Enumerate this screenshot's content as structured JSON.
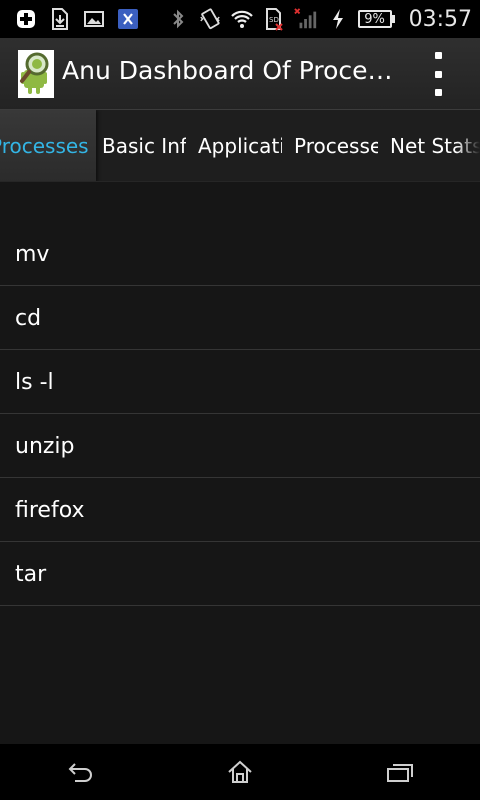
{
  "status_bar": {
    "icons": [
      "add-icon",
      "download-icon",
      "image-icon",
      "app-icon",
      "bluetooth-icon",
      "vibrate-icon",
      "wifi-icon",
      "sd-card-icon",
      "signal-icon",
      "charging-icon"
    ],
    "battery": "9%",
    "time": "03:57"
  },
  "action_bar": {
    "title": "Anu Dashboard Of Proce…",
    "menu_icon": "overflow-menu-icon"
  },
  "tabs": [
    {
      "label": "Processes",
      "active": true
    },
    {
      "label": "Basic Info",
      "active": false
    },
    {
      "label": "Applications",
      "active": false
    },
    {
      "label": "Processes",
      "active": false
    },
    {
      "label": "Net Stats",
      "active": false
    }
  ],
  "list": {
    "items": [
      "mv",
      "cd",
      "ls -l",
      "unzip",
      "firefox",
      "tar"
    ]
  },
  "nav_bar": {
    "icons": [
      "back-icon",
      "home-icon",
      "recent-apps-icon"
    ]
  },
  "colors": {
    "accent": "#33b5e5",
    "background": "#161616",
    "status_bar": "#000000"
  }
}
